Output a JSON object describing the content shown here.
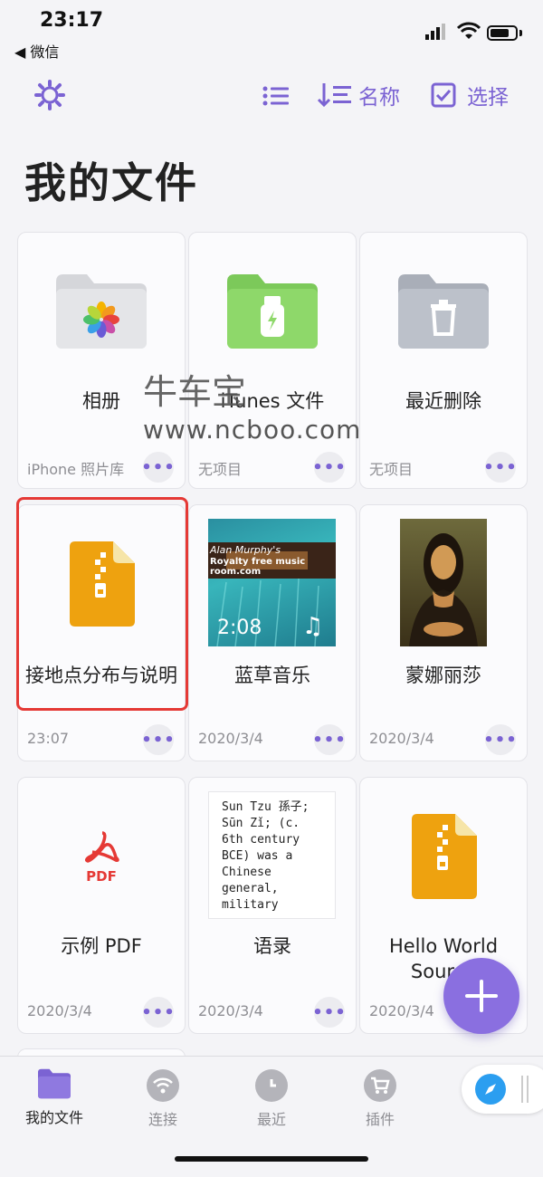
{
  "status": {
    "time": "23:17",
    "back": "◀ 微信"
  },
  "toolbar": {
    "sort_label": "名称",
    "select_label": "选择"
  },
  "title": "我的文件",
  "watermark": {
    "line1": "牛车宝",
    "line2": "www.ncboo.com"
  },
  "cards": [
    {
      "name": "相册",
      "meta": "iPhone 照片库"
    },
    {
      "name": "iTunes 文件",
      "meta": "无项目"
    },
    {
      "name": "最近删除",
      "meta": "无项目"
    },
    {
      "name": "接地点分布与说明",
      "meta": "23:07"
    },
    {
      "name": "蓝草音乐",
      "meta": "2020/3/4",
      "duration": "2:08",
      "banner1": "Alan Murphy's",
      "banner2": "Royalty free music room.com"
    },
    {
      "name": "蒙娜丽莎",
      "meta": "2020/3/4"
    },
    {
      "name": "示例 PDF",
      "meta": "2020/3/4",
      "badge": "PDF"
    },
    {
      "name": "语录",
      "meta": "2020/3/4",
      "preview": "Sun Tzu 孫子; Sūn Zǐ; (c. 6th century BCE) was a Chinese general, military"
    },
    {
      "name": "Hello World Source",
      "meta": "2020/3/4"
    }
  ],
  "tabs": [
    {
      "label": "我的文件"
    },
    {
      "label": "连接"
    },
    {
      "label": "最近"
    },
    {
      "label": "插件"
    }
  ],
  "colors": {
    "accent": "#7b63d3",
    "highlight": "#e53935"
  }
}
